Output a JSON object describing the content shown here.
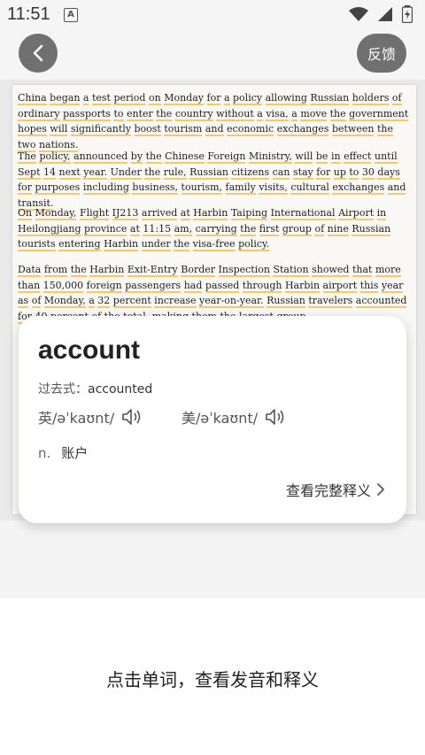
{
  "status": {
    "time": "11:51",
    "notif_icon": "A"
  },
  "topbar": {
    "feedback_label": "反馈"
  },
  "article": {
    "paragraphs": [
      "China began a test period on Monday for a policy allowing Russian holders of ordinary passports to enter the country without a visa, a move the government hopes will significantly boost tourism and economic exchanges between the two nations.",
      "The policy, announced by the Chinese Foreign Ministry, will be in effect until Sept 14 next year. Under the rule, Russian citizens can stay for up to 30 days for purposes including business, tourism, family visits, cultural exchanges and transit.",
      "On Monday, Flight IJ213 arrived at Harbin Taiping International Airport in Heilongjiang province at 11:15 am, carrying the first group of nine Russian tourists entering Harbin under the visa-free policy.",
      "Data from the Harbin Exit-Entry Border Inspection Station showed that more than 150,000 foreign passengers had passed through Harbin airport this year as of Monday, a 32 percent increase year-on-year. Russian travelers accounted for 40 percent of the total, making them the largest group."
    ]
  },
  "popup": {
    "word": "account",
    "past_label": "过去式：",
    "past_value": "accounted",
    "uk_phonetic": "英/əˈkaʊnt/",
    "us_phonetic": "美/əˈkaʊnt/",
    "pos": "n.",
    "meaning": "账户",
    "full_link": "查看完整释义"
  },
  "caption": "点击单词，查看发音和释义"
}
